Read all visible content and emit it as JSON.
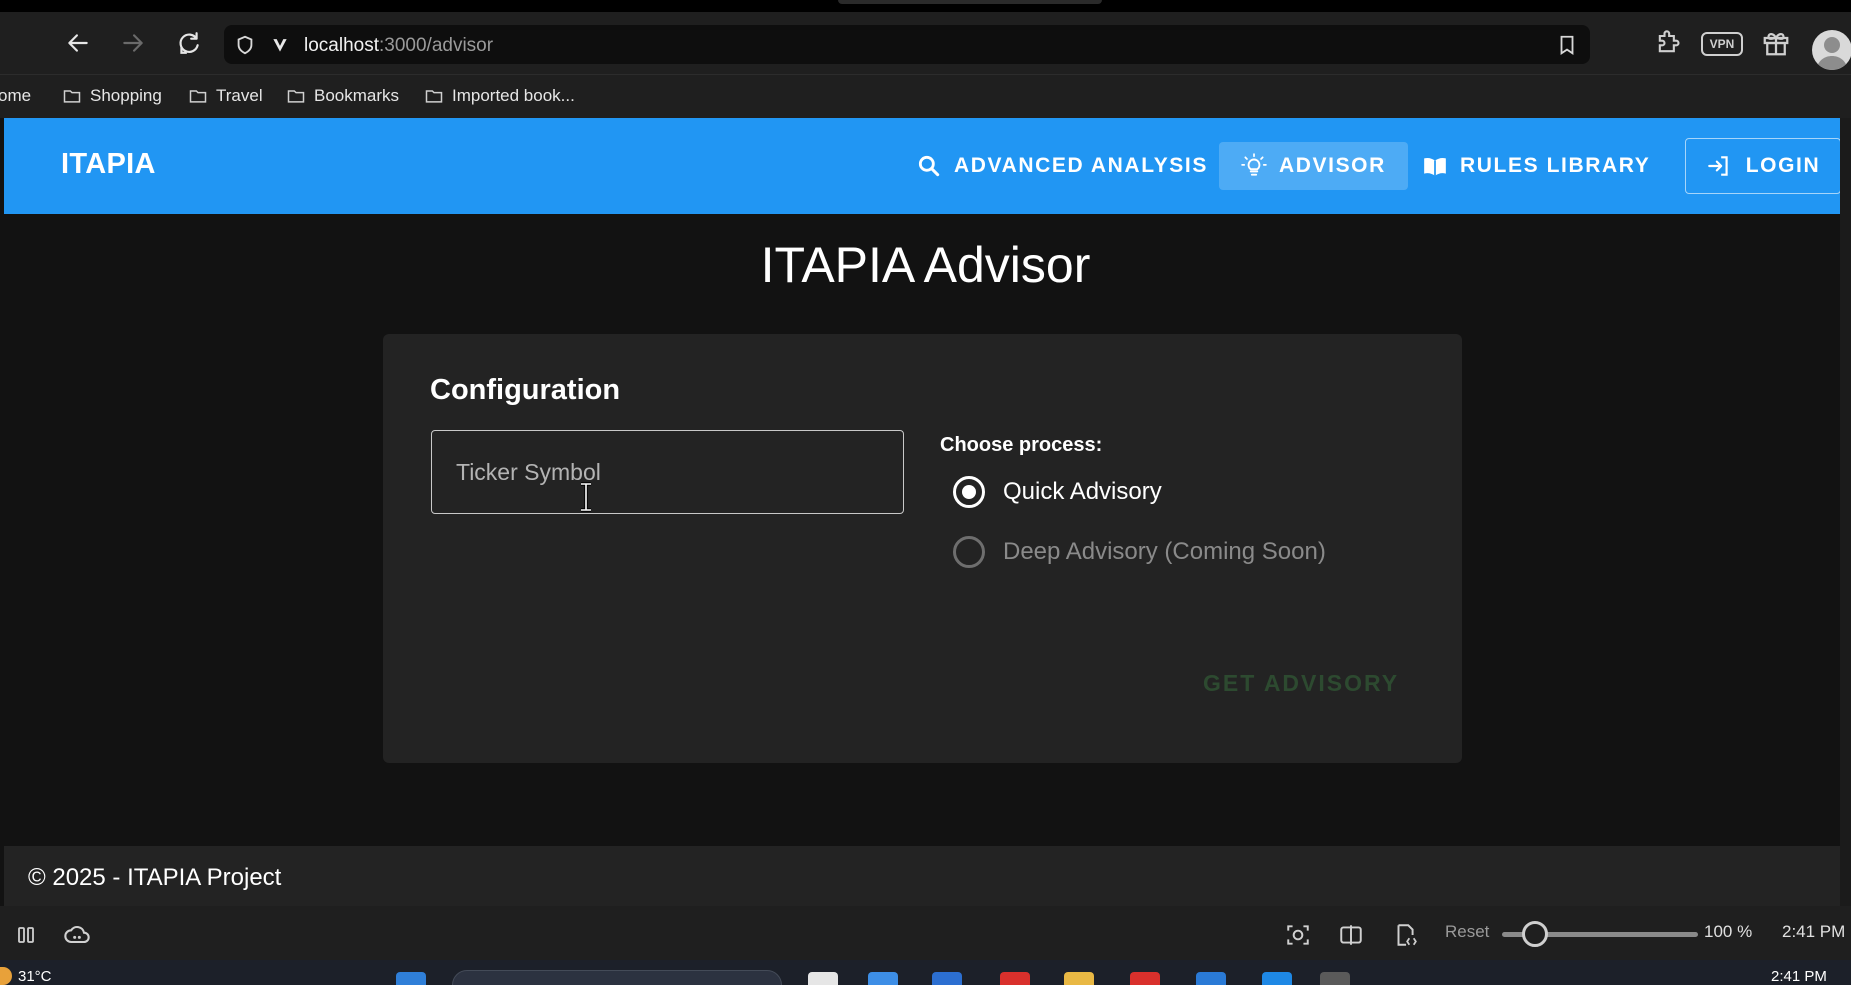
{
  "browser": {
    "url_host": "localhost",
    "url_path": ":3000/advisor",
    "vpn_label": "VPN"
  },
  "bookmarks": [
    {
      "label": "ome",
      "icon": "home-icon"
    },
    {
      "label": "Shopping",
      "icon": "folder-icon"
    },
    {
      "label": "Travel",
      "icon": "folder-icon"
    },
    {
      "label": "Bookmarks",
      "icon": "folder-icon"
    },
    {
      "label": "Imported book...",
      "icon": "folder-icon"
    }
  ],
  "header": {
    "brand": "ITAPIA",
    "nav": [
      {
        "label": "ADVANCED ANALYSIS",
        "icon": "search-icon",
        "active": false
      },
      {
        "label": "ADVISOR",
        "icon": "lightbulb-icon",
        "active": true
      },
      {
        "label": "RULES LIBRARY",
        "icon": "book-icon",
        "active": false
      }
    ],
    "login_label": "LOGIN"
  },
  "page": {
    "title": "ITAPIA Advisor",
    "card": {
      "title": "Configuration",
      "ticker_placeholder": "Ticker Symbol",
      "ticker_value": "",
      "process_label": "Choose process:",
      "options": [
        {
          "label": "Quick Advisory",
          "checked": true,
          "disabled": false
        },
        {
          "label": "Deep Advisory (Coming Soon)",
          "checked": false,
          "disabled": true
        }
      ],
      "submit_label": "GET ADVISORY"
    }
  },
  "footer": {
    "text": "© 2025 - ITAPIA Project"
  },
  "statusbar": {
    "reset_label": "Reset",
    "zoom_level": "100 %",
    "zoom_fraction": 0.17,
    "time": "2:41 PM"
  },
  "taskbar": {
    "temperature": "31°C",
    "clock": "2:41 PM"
  },
  "colors": {
    "header_bg": "#2196f3",
    "page_bg": "#121212",
    "card_bg": "#232323",
    "disabled_button_text": "#2d4a30"
  }
}
